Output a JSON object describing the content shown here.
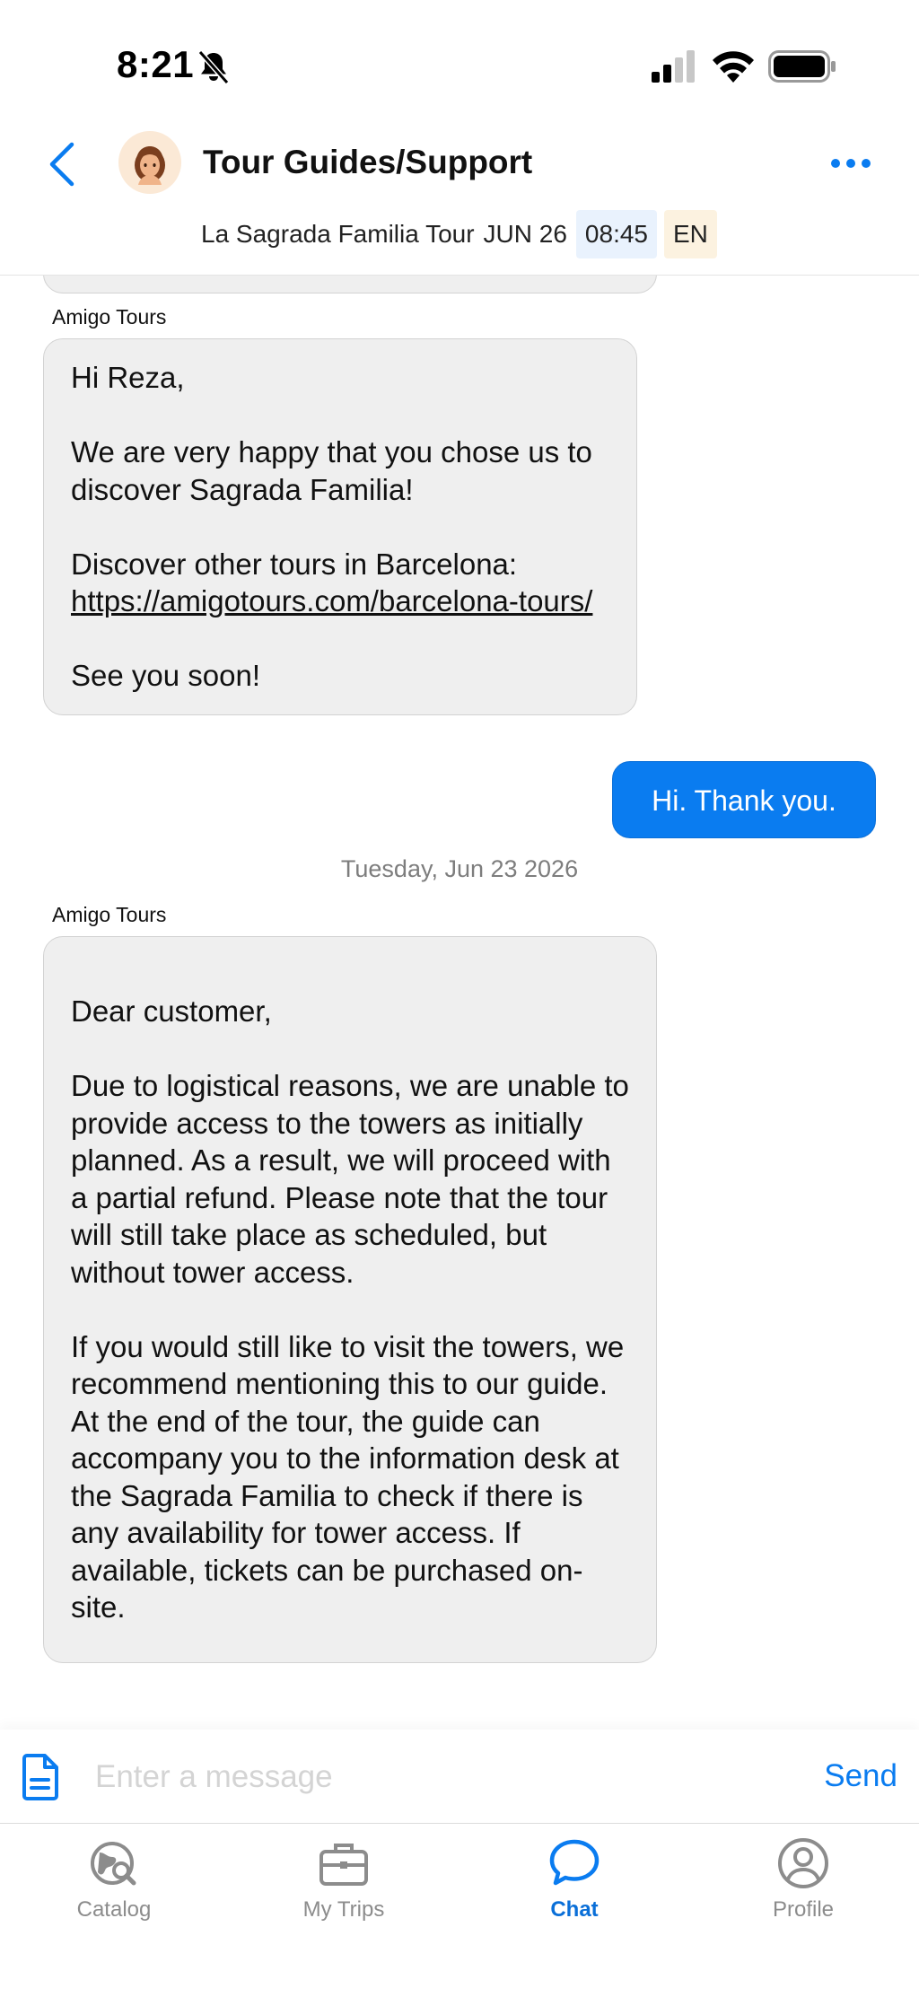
{
  "status_bar": {
    "time": "8:21"
  },
  "header": {
    "title": "Tour Guides/Support",
    "tour_name": "La Sagrada Familia Tour",
    "tour_date": "JUN 26",
    "tour_time": "08:45",
    "language": "EN"
  },
  "messages": [
    {
      "sender": "Amigo Tours",
      "paragraphs": [
        "Hi Reza,",
        "We are very happy that you chose us to discover Sagrada Familia!",
        "Discover other tours in Barcelona:",
        "See you soon!"
      ],
      "link": "https://amigotours.com/barcelona-tours/"
    },
    {
      "outgoing_text": "Hi. Thank you."
    },
    {
      "date_separator": "Tuesday, Jun 23 2026",
      "sender": "Amigo Tours",
      "paragraphs": [
        "Dear customer,",
        "Due to logistical reasons, we are unable to provide access to the towers as initially planned. As a result, we will proceed with a partial refund. Please note that the tour will still take place as scheduled, but without tower access.",
        "If you would still like to visit the towers, we recommend mentioning this to our guide. At the end of the tour, the guide can accompany you to the information desk at the Sagrada Familia to check if there is any availability for tower access. If available, tickets can be purchased on-site."
      ]
    }
  ],
  "composer": {
    "placeholder": "Enter a message",
    "value": "",
    "send_label": "Send"
  },
  "tabs": [
    {
      "label": "Catalog",
      "icon": "globe-search-icon",
      "active": false
    },
    {
      "label": "My Trips",
      "icon": "briefcase-icon",
      "active": false
    },
    {
      "label": "Chat",
      "icon": "chat-bubble-icon",
      "active": true
    },
    {
      "label": "Profile",
      "icon": "profile-icon",
      "active": false
    }
  ],
  "colors": {
    "accent": "#0a7cf0",
    "bubble_in": "#efefef",
    "muted": "#8c8c8c"
  }
}
